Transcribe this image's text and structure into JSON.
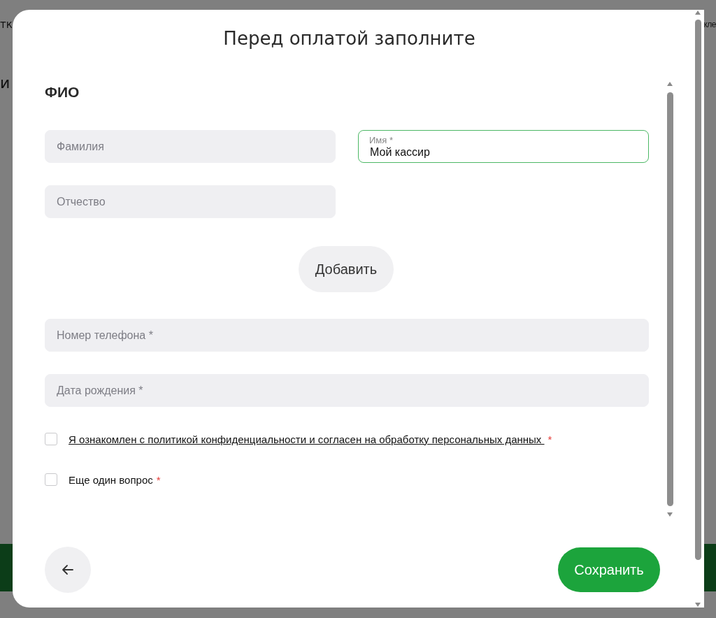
{
  "background_fragments": [
    "тк",
    "кле",
    "и"
  ],
  "dialog": {
    "title": "Перед оплатой заполните"
  },
  "section_title": "ФИО",
  "name_fields": [
    {
      "kind": "placeholder",
      "placeholder": "Фамилия",
      "focused": false
    },
    {
      "kind": "floating",
      "label": "Имя *",
      "value": "Мой кассир",
      "focused": true
    },
    {
      "kind": "placeholder",
      "placeholder": "Отчество",
      "focused": false
    }
  ],
  "add_button": "Добавить",
  "fields": [
    {
      "placeholder": "Номер телефона *"
    },
    {
      "placeholder": "Дата рождения *"
    }
  ],
  "checkboxes": [
    {
      "kind": "link",
      "label": "Я ознакомлен с политикой конфиденциальности и согласен на обработку персональных данных ",
      "required_mark": "*",
      "checked": false
    },
    {
      "kind": "text",
      "label": "Еще один вопрос",
      "required_mark": "*",
      "checked": false
    }
  ],
  "save_button": "Сохранить"
}
